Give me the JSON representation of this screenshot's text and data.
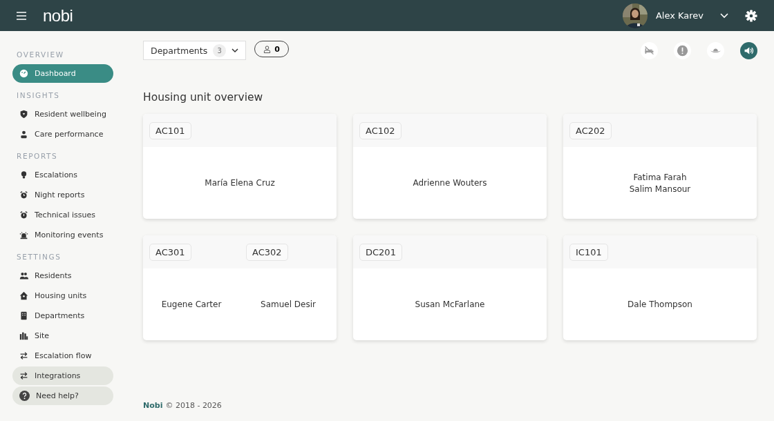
{
  "header": {
    "logo": "nobi",
    "user": {
      "name": "Alex Karev"
    }
  },
  "sidebar": {
    "sections": [
      {
        "title": "OVERVIEW",
        "items": [
          {
            "label": "Dashboard",
            "selected": true,
            "highlighted": false
          }
        ]
      },
      {
        "title": "INSIGHTS",
        "items": [
          {
            "label": "Resident wellbeing",
            "selected": false,
            "highlighted": false
          },
          {
            "label": "Care performance",
            "selected": false,
            "highlighted": false
          }
        ]
      },
      {
        "title": "REPORTS",
        "items": [
          {
            "label": "Escalations",
            "selected": false,
            "highlighted": false
          },
          {
            "label": "Night reports",
            "selected": false,
            "highlighted": false
          },
          {
            "label": "Technical issues",
            "selected": false,
            "highlighted": false
          },
          {
            "label": "Monitoring events",
            "selected": false,
            "highlighted": false
          }
        ]
      },
      {
        "title": "SETTINGS",
        "items": [
          {
            "label": "Residents",
            "selected": false,
            "highlighted": false
          },
          {
            "label": "Housing units",
            "selected": false,
            "highlighted": false
          },
          {
            "label": "Departments",
            "selected": false,
            "highlighted": false
          },
          {
            "label": "Site",
            "selected": false,
            "highlighted": false
          },
          {
            "label": "Escalation flow",
            "selected": false,
            "highlighted": false
          },
          {
            "label": "Integrations",
            "selected": false,
            "highlighted": true
          }
        ]
      }
    ],
    "help_button": {
      "label": "Need help?"
    }
  },
  "toolbar": {
    "departments": {
      "label": "Departments",
      "count": "3"
    },
    "staff_badge": "0",
    "status_buttons": [
      {
        "active": false
      },
      {
        "active": false
      },
      {
        "active": false
      },
      {
        "active": true
      }
    ]
  },
  "title": "Housing unit overview",
  "cards": [
    {
      "units": [
        {
          "code": "AC101",
          "residents": [
            "María Elena Cruz"
          ]
        }
      ]
    },
    {
      "units": [
        {
          "code": "AC102",
          "residents": [
            "Adrienne Wouters"
          ]
        }
      ]
    },
    {
      "units": [
        {
          "code": "AC202",
          "residents": [
            "Fatima Farah",
            "Salim Mansour"
          ]
        }
      ]
    },
    {
      "units": [
        {
          "code": "AC301",
          "residents": [
            "Eugene Carter"
          ]
        },
        {
          "code": "AC302",
          "residents": [
            "Samuel Desir"
          ]
        }
      ]
    },
    {
      "units": [
        {
          "code": "DC201",
          "residents": [
            "Susan McFarlane"
          ]
        }
      ]
    },
    {
      "units": [
        {
          "code": "IC101",
          "residents": [
            "Dale Thompson"
          ]
        }
      ]
    }
  ],
  "footer": {
    "brand": "Nobi",
    "text": "© 2018 - 2026"
  }
}
